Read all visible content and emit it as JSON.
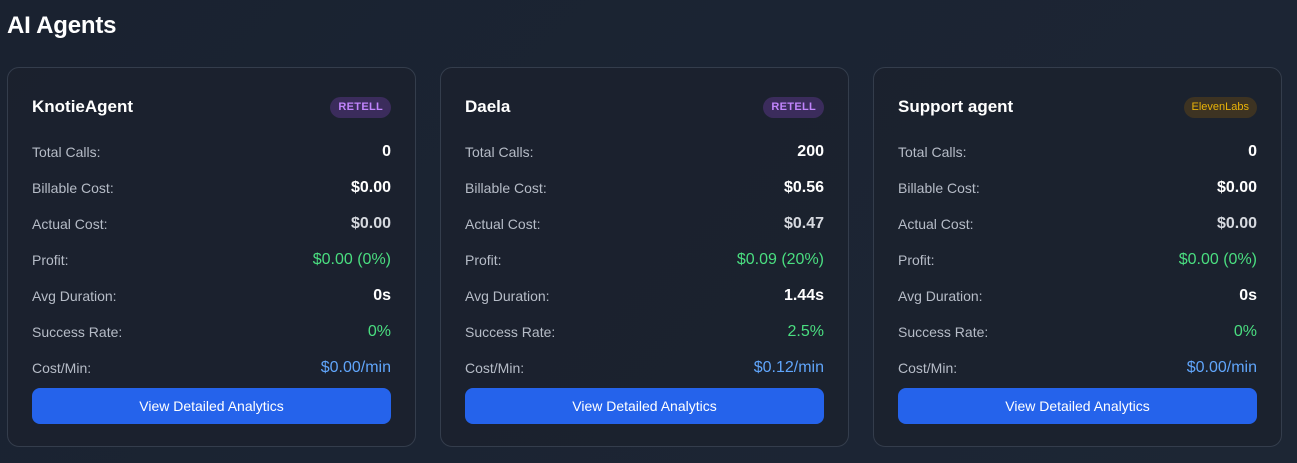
{
  "page": {
    "title": "AI Agents"
  },
  "labels": {
    "total_calls": "Total Calls:",
    "billable_cost": "Billable Cost:",
    "actual_cost": "Actual Cost:",
    "profit": "Profit:",
    "avg_duration": "Avg Duration:",
    "success_rate": "Success Rate:",
    "cost_per_min": "Cost/Min:",
    "cta": "View Detailed Analytics"
  },
  "colors": {
    "accent_blue": "#2563eb",
    "profit_green": "#4ade80",
    "rate_blue": "#60a5fa",
    "retell_badge": "#c084fc",
    "elevenlabs_badge": "#eab308"
  },
  "agents": [
    {
      "name": "KnotieAgent",
      "provider": "RETELL",
      "total_calls": "0",
      "billable_cost": "$0.00",
      "actual_cost": "$0.00",
      "profit": "$0.00 (0%)",
      "avg_duration": "0s",
      "success_rate": "0%",
      "cost_per_min": "$0.00/min"
    },
    {
      "name": "Daela",
      "provider": "RETELL",
      "total_calls": "200",
      "billable_cost": "$0.56",
      "actual_cost": "$0.47",
      "profit": "$0.09 (20%)",
      "avg_duration": "1.44s",
      "success_rate": "2.5%",
      "cost_per_min": "$0.12/min"
    },
    {
      "name": "Support agent",
      "provider": "ElevenLabs",
      "total_calls": "0",
      "billable_cost": "$0.00",
      "actual_cost": "$0.00",
      "profit": "$0.00 (0%)",
      "avg_duration": "0s",
      "success_rate": "0%",
      "cost_per_min": "$0.00/min"
    }
  ]
}
